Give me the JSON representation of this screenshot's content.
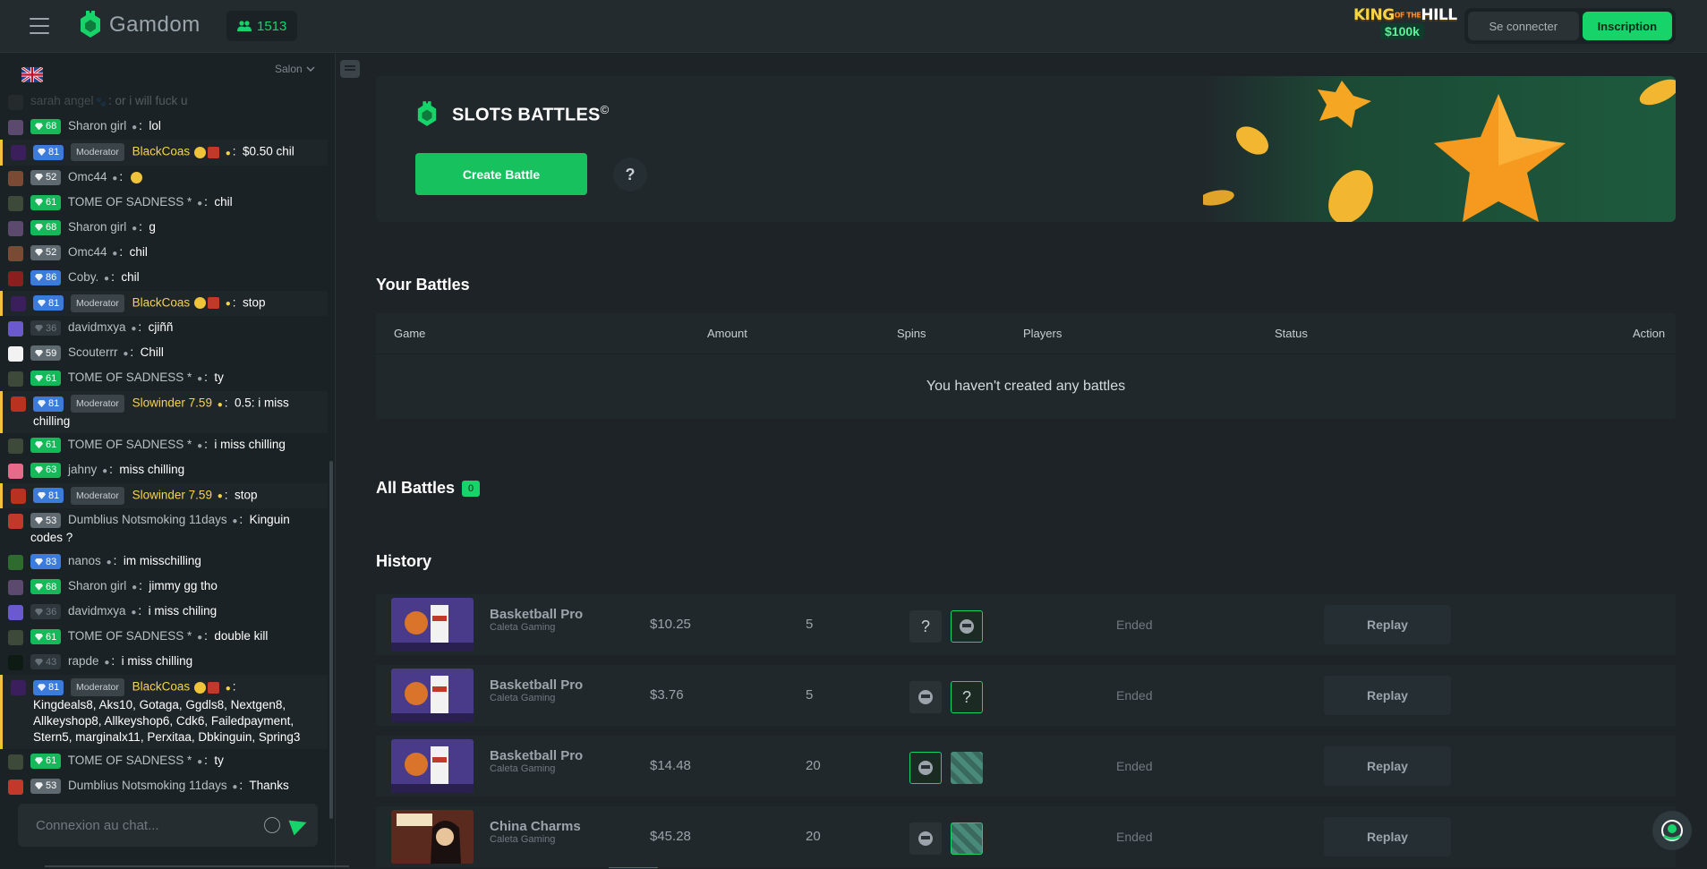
{
  "header": {
    "brand": "Gamdom",
    "online_count": "1513",
    "promo": {
      "line1_a": "KING",
      "line1_of": "OF THE",
      "line1_b": "HILL",
      "prize": "$100k"
    },
    "login_label": "Se connecter",
    "signup_label": "Inscription"
  },
  "chat": {
    "room_label": "Salon",
    "input_placeholder": "Connexion au chat...",
    "messages": [
      {
        "level": "",
        "user": "sarah angel",
        "text": "or i will fuck u"
      },
      {
        "level": "68",
        "user": "Sharon girl",
        "text": "lol"
      },
      {
        "level": "81",
        "badge": "Moderator",
        "user": "BlackCoas",
        "text": "$0.50 chil"
      },
      {
        "level": "52",
        "user": "Omc44",
        "text": ""
      },
      {
        "level": "61",
        "user": "TOME OF SADNESS *",
        "text": "chil"
      },
      {
        "level": "68",
        "user": "Sharon girl",
        "text": "g"
      },
      {
        "level": "52",
        "user": "Omc44",
        "text": "chil"
      },
      {
        "level": "86",
        "user": "Coby.",
        "text": "chil"
      },
      {
        "level": "81",
        "badge": "Moderator",
        "user": "BlackCoas",
        "text": "stop"
      },
      {
        "level": "36",
        "user": "davidmxya",
        "text": "cjiññ"
      },
      {
        "level": "59",
        "user": "Scouterrr",
        "text": "Chill"
      },
      {
        "level": "61",
        "user": "TOME OF SADNESS *",
        "text": "ty"
      },
      {
        "level": "81",
        "badge": "Moderator",
        "user": "Slowinder 7.59",
        "text": "0.5: i miss chilling"
      },
      {
        "level": "61",
        "user": "TOME OF SADNESS *",
        "text": "i miss chilling"
      },
      {
        "level": "63",
        "user": "jahny",
        "text": "miss chilling"
      },
      {
        "level": "81",
        "badge": "Moderator",
        "user": "Slowinder 7.59",
        "text": "stop"
      },
      {
        "level": "53",
        "user": "Dumblius Notsmoking 11days",
        "text": "Kinguin codes ?"
      },
      {
        "level": "83",
        "user": "nanos",
        "text": "im misschilling"
      },
      {
        "level": "68",
        "user": "Sharon girl",
        "text": "jimmy gg tho"
      },
      {
        "level": "36",
        "user": "davidmxya",
        "text": "i miss chiling"
      },
      {
        "level": "61",
        "user": "TOME OF SADNESS *",
        "text": "double kill"
      },
      {
        "level": "43",
        "user": "rapde",
        "text": "i miss chilling"
      },
      {
        "level": "81",
        "badge": "Moderator",
        "user": "BlackCoas",
        "text": "Kingdeals8, Aks10, Gotaga, Ggdls8, Nextgen8, Allkeyshop8, Allkeyshop6, Cdk6, Failedpayment, Stern5, marginalx11, Perxitaa, Dbkinguin, Spring3"
      },
      {
        "level": "61",
        "user": "TOME OF SADNESS *",
        "text": "ty"
      },
      {
        "level": "53",
        "user": "Dumblius Notsmoking 11days",
        "text": "Thanks"
      }
    ]
  },
  "hero": {
    "title": "SLOTS BATTLES",
    "title_mark": "©",
    "create_label": "Create Battle",
    "help_label": "?"
  },
  "your_battles": {
    "title": "Your Battles",
    "columns": [
      "Game",
      "Amount",
      "Spins",
      "Players",
      "Status",
      "Action"
    ],
    "empty": "You haven't created any battles"
  },
  "all_battles": {
    "title": "All Battles",
    "count": "0"
  },
  "history": {
    "title": "History",
    "rows": [
      {
        "game": "Basketball Pro",
        "provider": "Caleta Gaming",
        "amount": "$10.25",
        "spins": "5",
        "status": "Ended",
        "action": "Replay"
      },
      {
        "game": "Basketball Pro",
        "provider": "Caleta Gaming",
        "amount": "$3.76",
        "spins": "5",
        "status": "Ended",
        "action": "Replay"
      },
      {
        "game": "Basketball Pro",
        "provider": "Caleta Gaming",
        "amount": "$14.48",
        "spins": "20",
        "status": "Ended",
        "action": "Replay"
      },
      {
        "game": "China Charms",
        "provider": "Caleta Gaming",
        "amount": "$45.28",
        "spins": "20",
        "status": "Ended",
        "action": "Replay"
      }
    ]
  },
  "colors": {
    "accent": "#17d46a",
    "bg": "#1d2326",
    "panel": "#20282c",
    "moderator": "#f7d34a"
  }
}
